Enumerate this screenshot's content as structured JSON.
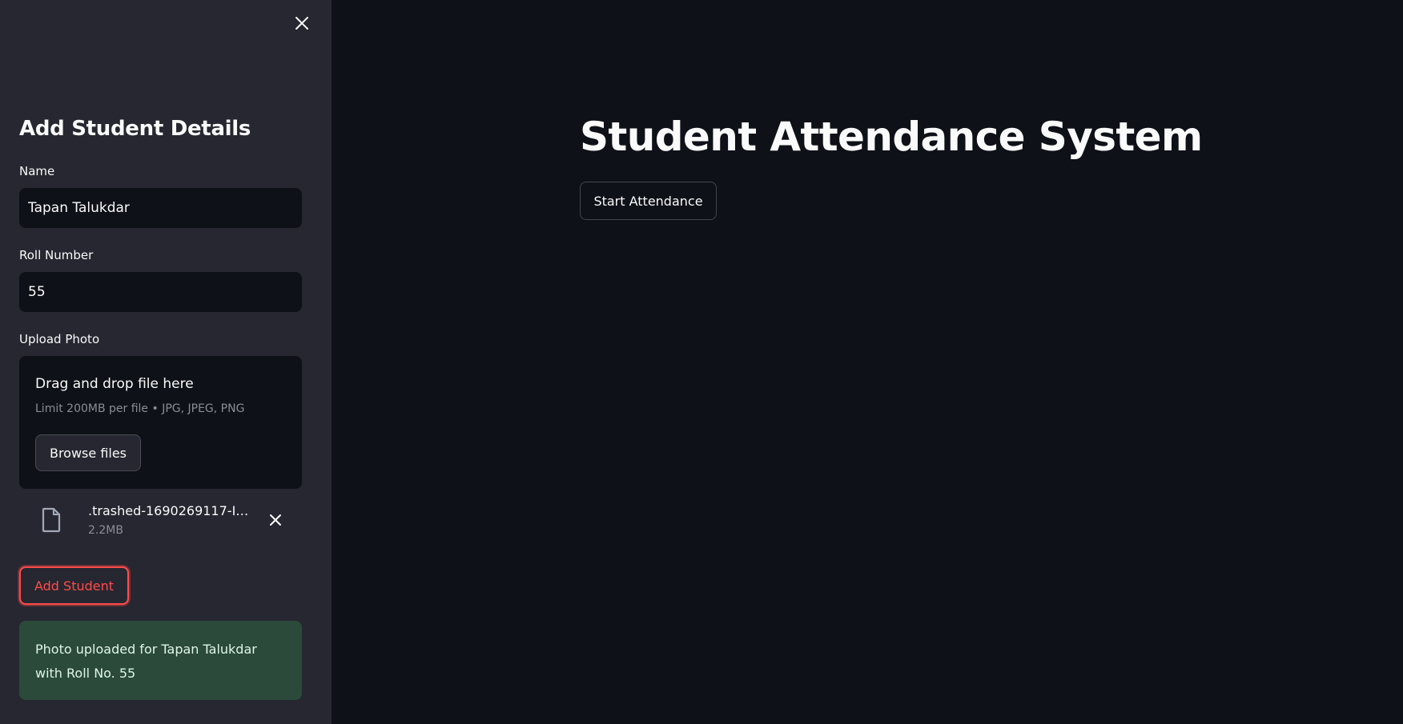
{
  "sidebar": {
    "title": "Add Student Details",
    "name_label": "Name",
    "name_value": "Tapan Talukdar",
    "roll_label": "Roll Number",
    "roll_value": "55",
    "upload_label": "Upload Photo",
    "dropzone": {
      "title": "Drag and drop file here",
      "subtitle": "Limit 200MB per file • JPG, JPEG, PNG",
      "browse_label": "Browse files"
    },
    "uploaded_file": {
      "name": ".trashed-1690269117-IM…",
      "size": "2.2MB",
      "icon": "file-icon"
    },
    "add_button_label": "Add Student",
    "success_message": "Photo uploaded for Tapan Talukdar with Roll No. 55"
  },
  "main": {
    "title": "Student Attendance System",
    "start_button_label": "Start Attendance"
  },
  "colors": {
    "background": "#0e1117",
    "sidebar": "#262730",
    "accent": "#ff4b4b",
    "success_bg": "#2b4a3a"
  }
}
